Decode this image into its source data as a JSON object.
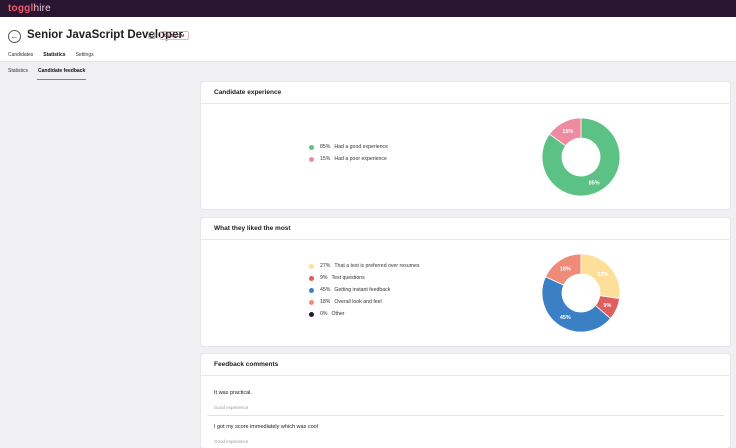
{
  "app": {
    "logo_main": "toggl",
    "logo_sub": "hire"
  },
  "header": {
    "title": "Senior JavaScript Developer",
    "badge": "CUSTOM",
    "tabs": [
      {
        "label": "Candidates"
      },
      {
        "label": "Statistics"
      },
      {
        "label": "Settings"
      }
    ]
  },
  "subtabs": [
    {
      "label": "Statistics"
    },
    {
      "label": "Candidate feedback"
    }
  ],
  "experience": {
    "title": "Candidate experience",
    "items": [
      {
        "pct": "85%",
        "label": "Had a good experience",
        "value": 85,
        "color": "#5cc184"
      },
      {
        "pct": "15%",
        "label": "Had a poor experience",
        "value": 15,
        "color": "#ee8ba0"
      }
    ]
  },
  "liked": {
    "title": "What they liked the most",
    "items": [
      {
        "pct": "27%",
        "label": "That a test is preferred over resumes",
        "value": 27,
        "color": "#fddf9a"
      },
      {
        "pct": "9%",
        "label": "Test questions",
        "value": 9,
        "color": "#df5e5e"
      },
      {
        "pct": "45%",
        "label": "Getting instant feedback",
        "value": 45,
        "color": "#3b7fc4"
      },
      {
        "pct": "18%",
        "label": "Overall look and feel",
        "value": 18,
        "color": "#ee8c78"
      },
      {
        "pct": "0%",
        "label": "Other",
        "value": 0,
        "color": "#261d2a"
      }
    ]
  },
  "comments": {
    "title": "Feedback comments",
    "items": [
      {
        "text": "It was practical.",
        "label": "Good experience"
      },
      {
        "text": "I got my score immediately which was cool",
        "label": "Good experience"
      }
    ]
  }
}
